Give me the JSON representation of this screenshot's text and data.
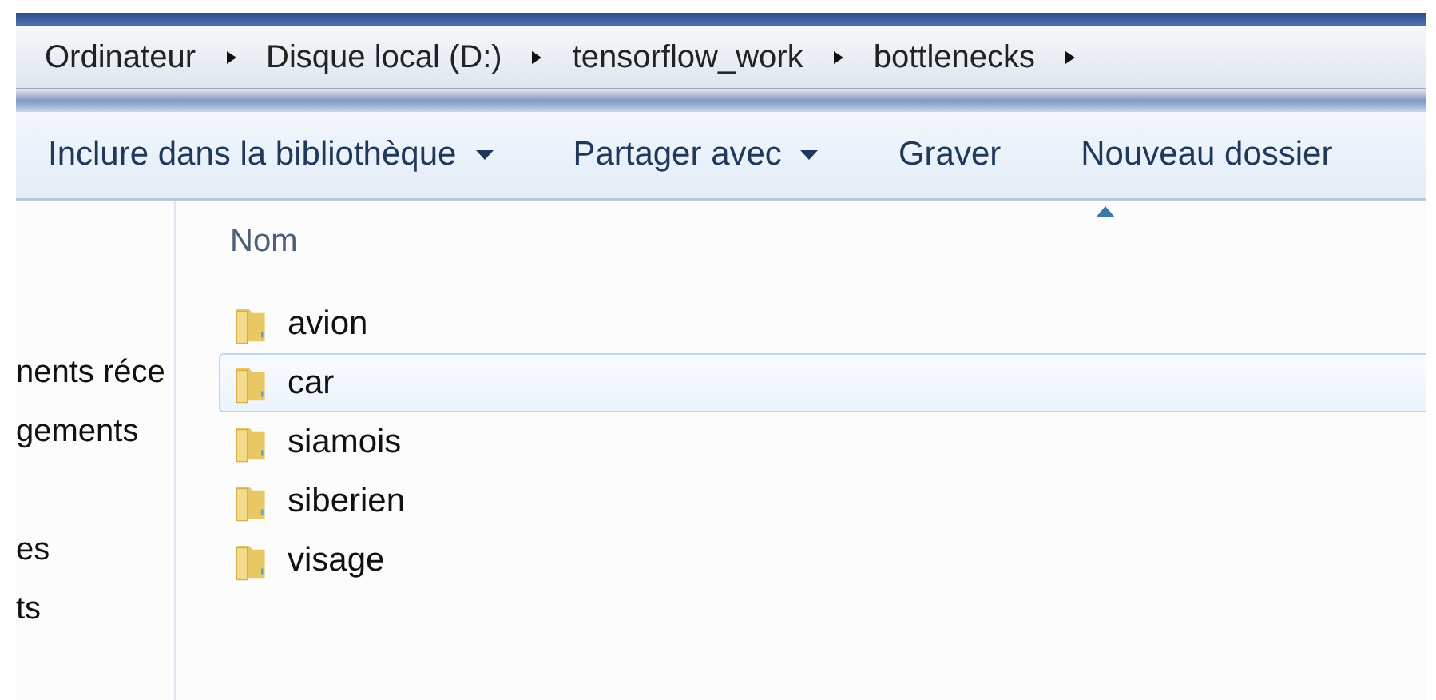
{
  "breadcrumb": [
    "Ordinateur",
    "Disque local (D:)",
    "tensorflow_work",
    "bottlenecks"
  ],
  "toolbar": [
    {
      "label": "Inclure dans la bibliothèque",
      "dropdown": true
    },
    {
      "label": "Partager avec",
      "dropdown": true
    },
    {
      "label": "Graver",
      "dropdown": false
    },
    {
      "label": "Nouveau dossier",
      "dropdown": false
    }
  ],
  "sidebar": {
    "items": [
      {
        "label": "nents réce"
      },
      {
        "label": "gements"
      },
      {
        "label": "es"
      },
      {
        "label": "ts"
      }
    ]
  },
  "file_list": {
    "column": "Nom",
    "sorted_ascending": true,
    "rows": [
      {
        "name": "avion",
        "selected": false
      },
      {
        "name": "car",
        "selected": true
      },
      {
        "name": "siamois",
        "selected": false
      },
      {
        "name": "siberien",
        "selected": false
      },
      {
        "name": "visage",
        "selected": false
      }
    ]
  }
}
